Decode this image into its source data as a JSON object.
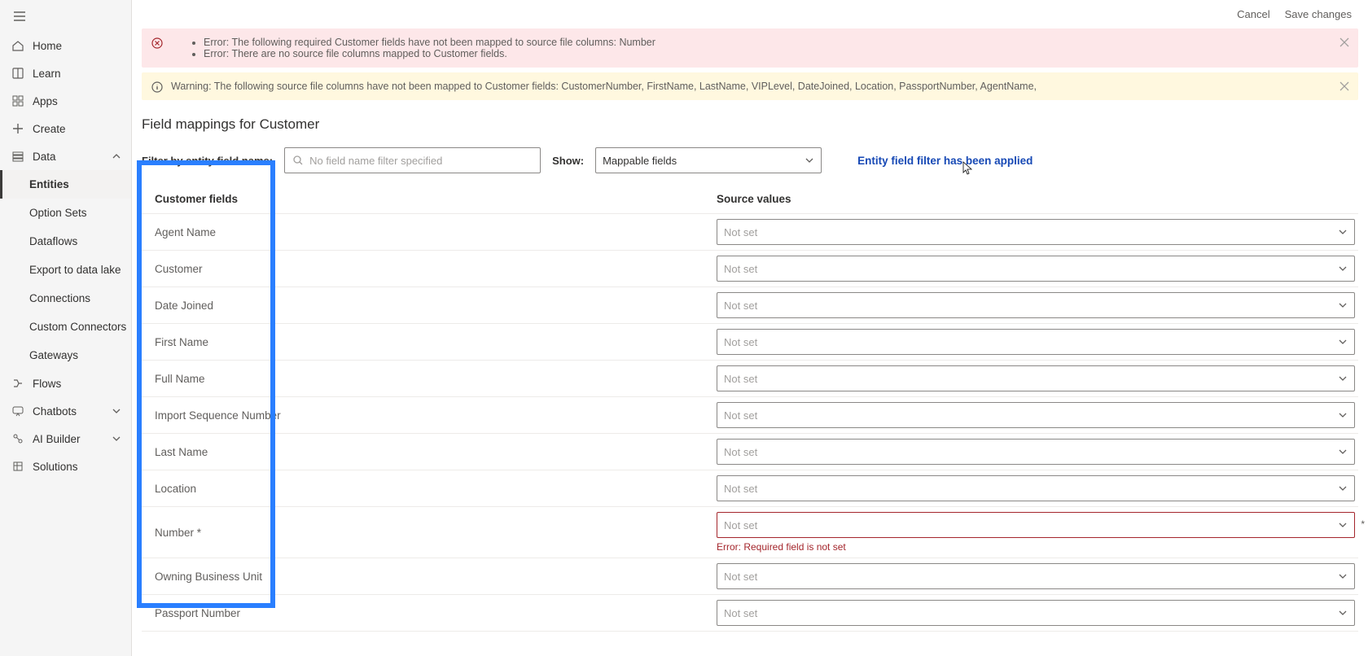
{
  "topbar": {
    "cancel": "Cancel",
    "save": "Save changes"
  },
  "sidebar": {
    "items": [
      {
        "label": "Home"
      },
      {
        "label": "Learn"
      },
      {
        "label": "Apps"
      },
      {
        "label": "Create"
      },
      {
        "label": "Data",
        "expanded": true,
        "children": [
          {
            "label": "Entities",
            "active": true
          },
          {
            "label": "Option Sets"
          },
          {
            "label": "Dataflows"
          },
          {
            "label": "Export to data lake"
          },
          {
            "label": "Connections"
          },
          {
            "label": "Custom Connectors"
          },
          {
            "label": "Gateways"
          }
        ]
      },
      {
        "label": "Flows"
      },
      {
        "label": "Chatbots",
        "chev": true
      },
      {
        "label": "AI Builder",
        "chev": true
      },
      {
        "label": "Solutions"
      }
    ]
  },
  "errorBanner": {
    "lines": [
      "Error: The following required Customer fields have not been mapped to source file columns: Number",
      "Error: There are no source file columns mapped to Customer fields."
    ]
  },
  "warningBanner": {
    "text": "Warning: The following source file columns have not been mapped to Customer fields: CustomerNumber, FirstName, LastName, VIPLevel, DateJoined, Location, PassportNumber, AgentName,"
  },
  "pageTitle": "Field mappings for Customer",
  "filterRow": {
    "filterLabel": "Filter by entity field name:",
    "filterPlaceholder": "No field name filter specified",
    "showLabel": "Show:",
    "showValue": "Mappable fields",
    "appliedMsg": "Entity field filter has been applied"
  },
  "table": {
    "h1": "Customer fields",
    "h2": "Source values",
    "notset": "Not set",
    "errMsg": "Error: Required field is not set",
    "rows": [
      {
        "name": "Agent Name"
      },
      {
        "name": "Customer"
      },
      {
        "name": "Date Joined"
      },
      {
        "name": "First Name"
      },
      {
        "name": "Full Name"
      },
      {
        "name": "Import Sequence Number"
      },
      {
        "name": "Last Name"
      },
      {
        "name": "Location"
      },
      {
        "name": "Number *",
        "err": true
      },
      {
        "name": "Owning Business Unit"
      },
      {
        "name": "Passport Number"
      }
    ]
  }
}
